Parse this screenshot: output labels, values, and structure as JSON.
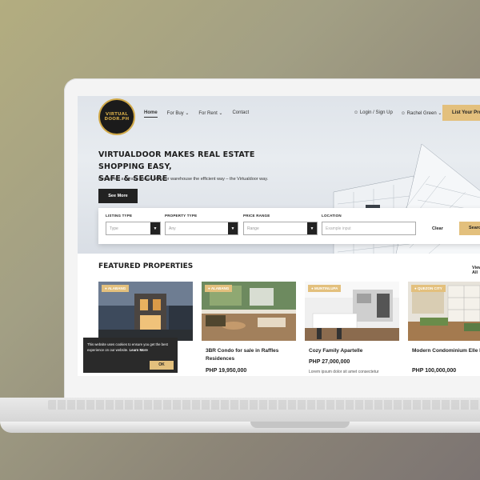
{
  "brand": {
    "logo_line1": "VIRTUAL",
    "logo_line2": "DOOR.PH",
    "accent": "#e3c07d"
  },
  "nav": {
    "home": "Home",
    "for_buy": "For Buy",
    "for_rent": "For Rent",
    "contact": "Contact",
    "login": "Login / Sign Up",
    "user": "Rachel Green",
    "list_property": "List Your Property"
  },
  "hero": {
    "headline_line1": "VIRTUALDOOR MAKES REAL ESTATE SHOPPING EASY,",
    "headline_line2": "SAFE & SECURE",
    "subline": "Buy or rent a condo, house, office or warehouse the efficient way – the Virtualdoor way.",
    "see_more": "See More"
  },
  "search": {
    "listing_type_label": "LISTING TYPE",
    "listing_type_value": "Type",
    "property_type_label": "PROPERTY TYPE",
    "property_type_value": "Any",
    "price_range_label": "PRICE RANGE",
    "price_range_value": "Range",
    "location_label": "LOCATION",
    "location_placeholder": "Example input",
    "clear": "Clear",
    "search": "Search"
  },
  "featured": {
    "title": "FEATURED PROPERTIES",
    "view_all": "View All",
    "cards": [
      {
        "tag": "ALABANG",
        "title": "",
        "price": "",
        "desc": ""
      },
      {
        "tag": "ALABANG",
        "title": "3BR Condo for sale in Raffles Residences",
        "price": "PHP 19,950,000",
        "desc": ""
      },
      {
        "tag": "MUNTINLUPA",
        "title": "Cozy Family Apartelle",
        "price": "PHP 27,000,000",
        "desc": "Lorem ipsum dolor sit amet consectetur"
      },
      {
        "tag": "QUEZON CITY",
        "title": "Modern Condominium Elle here",
        "price": "PHP 100,000,000",
        "desc": ""
      }
    ]
  },
  "cookie": {
    "text": "This website uses cookies to ensure you get the best experience on our website.",
    "link": "Learn More",
    "ok": "OK"
  }
}
